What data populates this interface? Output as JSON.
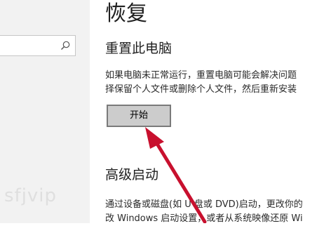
{
  "sidebar": {
    "search": {
      "placeholder": "",
      "icon": "search-icon"
    },
    "watermark": "sfjvip"
  },
  "main": {
    "title": "恢复",
    "reset": {
      "heading": "重置此电脑",
      "desc_line1": "如果电脑未正常运行，重置电脑可能会解决问题",
      "desc_line2": "择保留个人文件或删除个人文件，然后重新安装",
      "button_label": "开始"
    },
    "advanced": {
      "heading": "高级启动",
      "desc_line1": "通过设备或磁盘(如 U 盘或 DVD)启动，更改你的",
      "desc_line2": "改 Windows 启动设置，或者从系统映像还原 Wi"
    }
  },
  "colors": {
    "annotation_arrow": "#c8102e",
    "button_bg": "#cccccc",
    "button_border": "#7a7a7a"
  }
}
